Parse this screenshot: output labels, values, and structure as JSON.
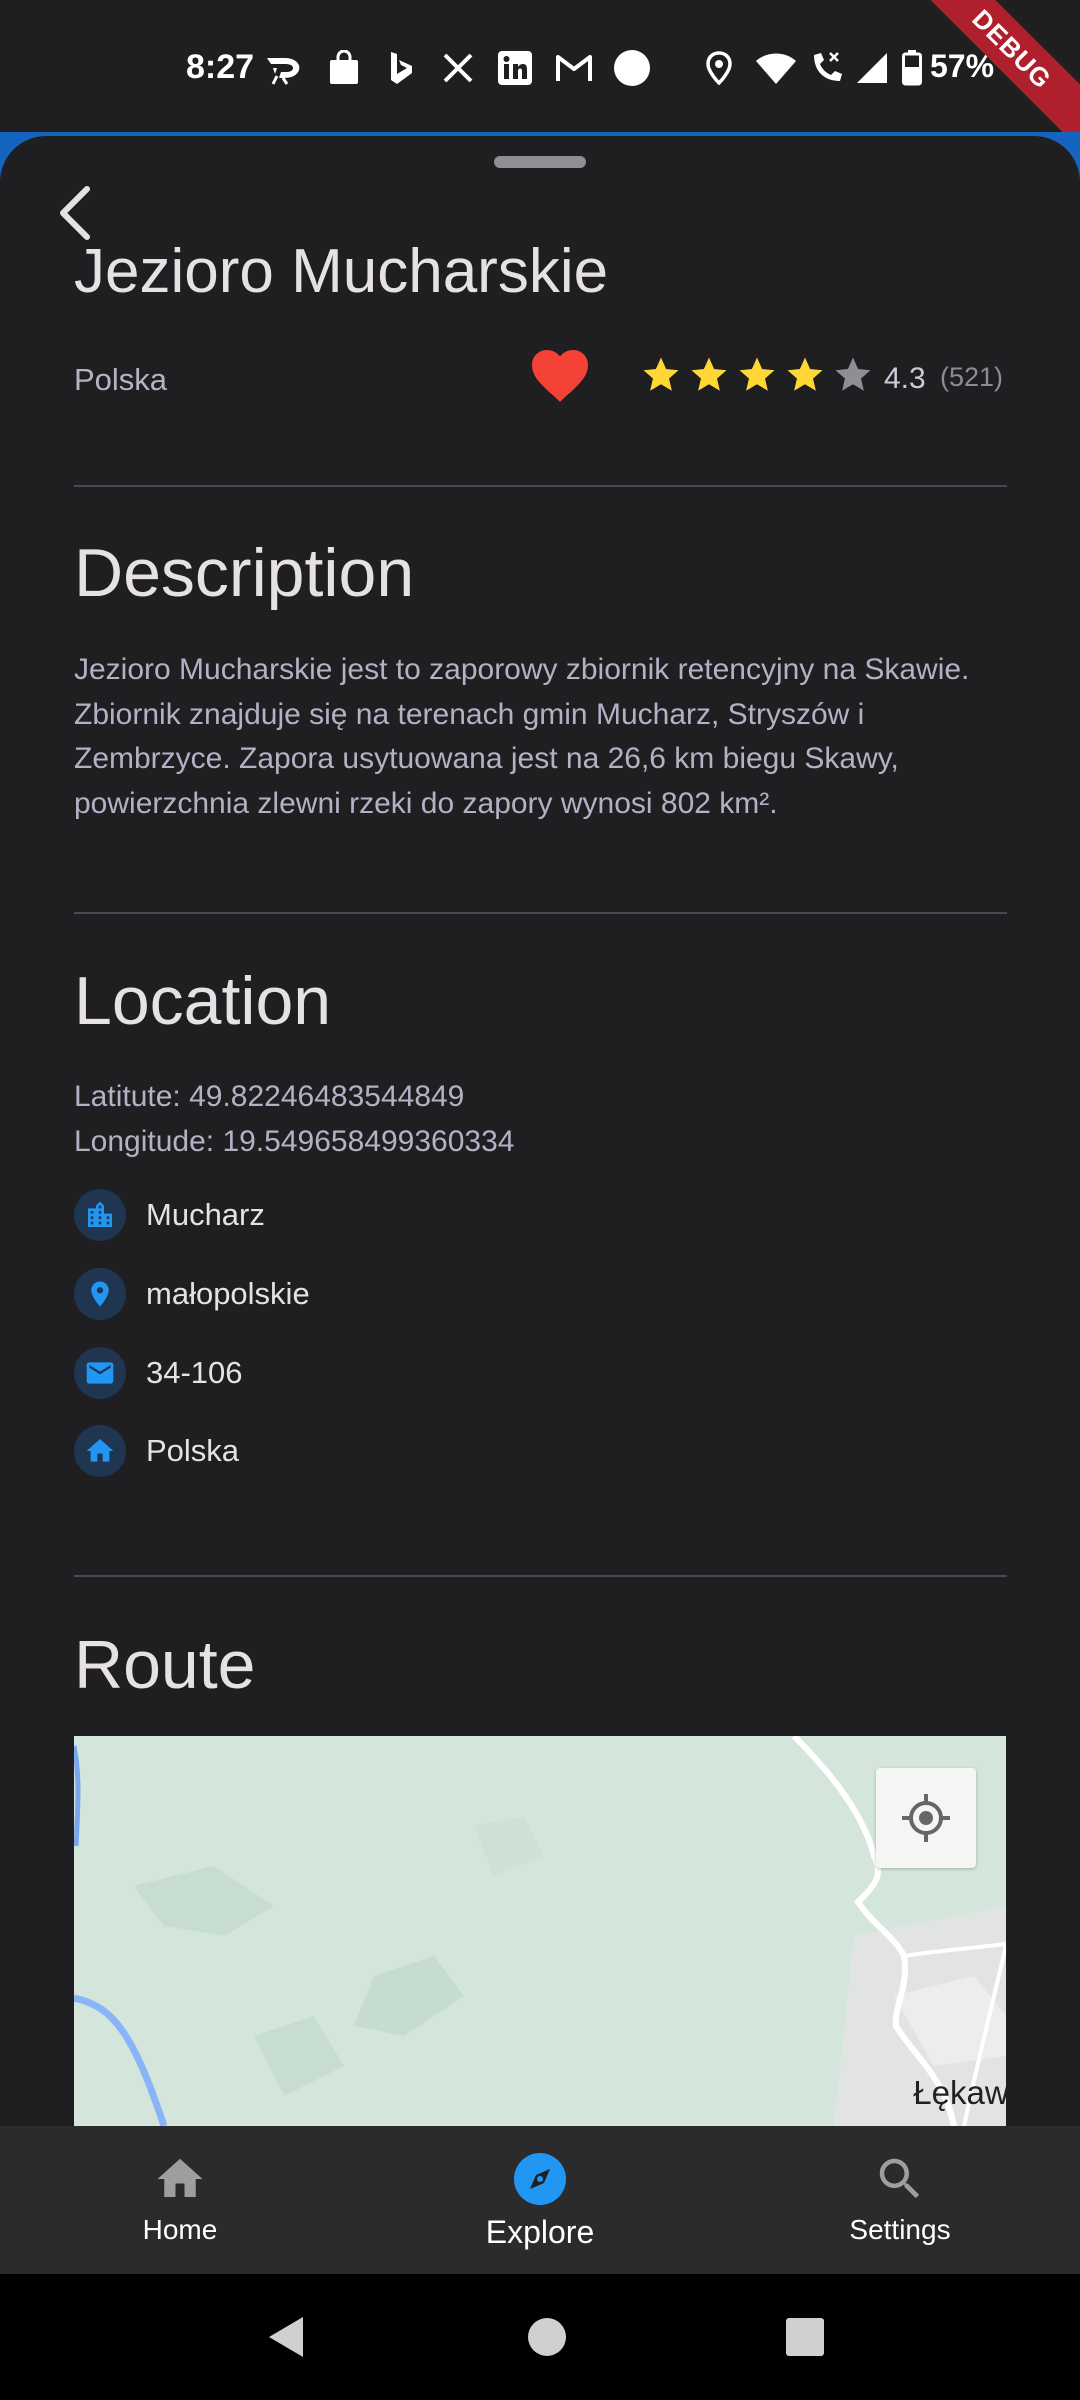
{
  "status_bar": {
    "time": "8:27",
    "battery": "57%",
    "icons": [
      "doordash-icon",
      "shopping-bag-icon",
      "bing-icon",
      "x-icon",
      "linkedin-icon",
      "gmail-icon",
      "circle-icon",
      "location-icon",
      "wifi-icon",
      "call-icon",
      "signal-icon",
      "battery-icon"
    ]
  },
  "debug_banner": "DEBUG",
  "place": {
    "name": "Jezioro Mucharskie",
    "country": "Polska",
    "rating": "4.3",
    "rating_count": "(521)",
    "stars_filled": 4,
    "stars_total": 5,
    "favorite": true
  },
  "description": {
    "title": "Description",
    "text": "Jezioro Mucharskie jest to zaporowy zbiornik retencyjny na Skawie. Zbiornik znajduje się na terenach gmin Mucharz, Stryszów i Zembrzyce. Zapora usytuowana jest na 26,6 km biegu Skawy, powierzchnia zlewni rzeki do zapory wynosi 802 km²."
  },
  "location": {
    "title": "Location",
    "latitude": "Latitute: 49.82246483544849",
    "longitude": "Longitude: 19.549658499360334",
    "address": [
      {
        "icon": "city-icon",
        "text": "Mucharz"
      },
      {
        "icon": "location-pin-icon",
        "text": "małopolskie"
      },
      {
        "icon": "mail-icon",
        "text": "34-106"
      },
      {
        "icon": "home-icon",
        "text": "Polska"
      }
    ]
  },
  "route": {
    "title": "Route",
    "map_label": "Łękawi"
  },
  "bottom_nav": {
    "items": [
      {
        "label": "Home",
        "icon": "home-icon",
        "active": false
      },
      {
        "label": "Explore",
        "icon": "compass-icon",
        "active": true
      },
      {
        "label": "Settings",
        "icon": "search-icon",
        "active": false
      }
    ]
  },
  "colors": {
    "background": "#1f1f21",
    "accent": "#2196f3",
    "star": "#fdd835",
    "heart": "#f44336"
  }
}
